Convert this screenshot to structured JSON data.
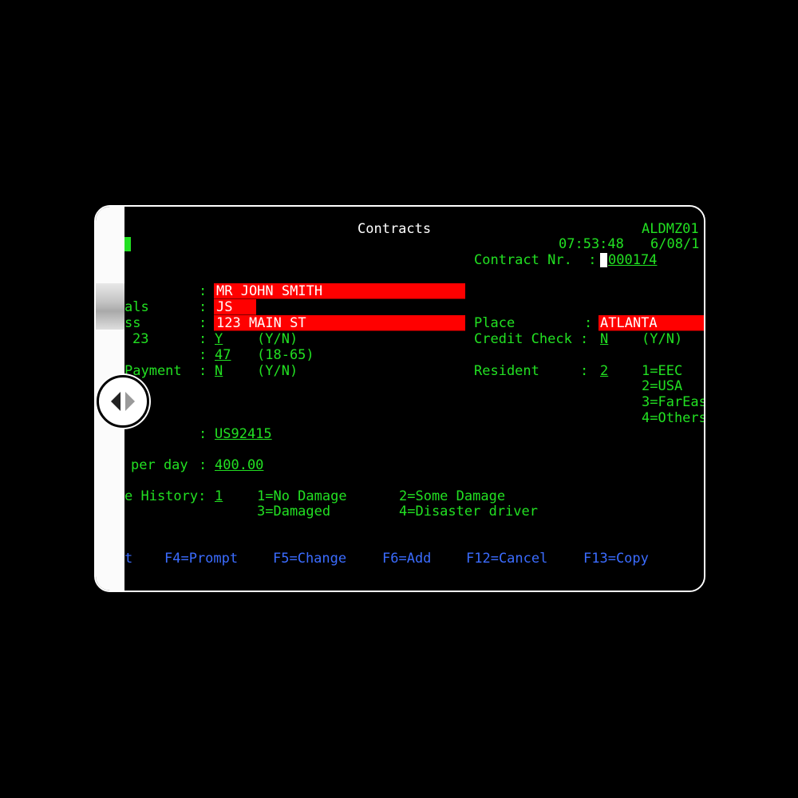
{
  "screen": {
    "title": "Contracts",
    "program_id": "ALDMZ01",
    "time": "07:53:48",
    "date": "6/08/1",
    "contract_label": "Contract Nr.  :",
    "contract_value": "000174"
  },
  "left_fields": {
    "name_value": "MR JOHN SMITH",
    "initials_label": "als",
    "initials_value": "JS",
    "address_label": "ss",
    "address_value": "123 MAIN ST",
    "row4_label": "23",
    "row4_value": "Y",
    "row4_hint": "(Y/N)",
    "age_value": "47",
    "age_hint": "(18-65)",
    "payment_label": "Payment",
    "payment_value": "N",
    "payment_hint": "(Y/N)",
    "id_value": "US92415",
    "rate_label": "per day",
    "rate_value": "400.00",
    "history_label": "e History:",
    "history_value": "1"
  },
  "history_options": {
    "opt1": "1=No Damage",
    "opt2": "2=Some Damage",
    "opt3": "3=Damaged",
    "opt4": "4=Disaster driver"
  },
  "right_fields": {
    "place_label": "Place",
    "place_value": "ATLANTA",
    "credit_label": "Credit Check :",
    "credit_value": "N",
    "credit_hint": "(Y/N)",
    "resident_label": "Resident     :",
    "resident_value": "2",
    "resident_options": [
      "1=EEC",
      "2=USA",
      "3=FarEas",
      "4=Others"
    ]
  },
  "function_keys": {
    "f_partial": "t",
    "f4": "F4=Prompt",
    "f5": "F5=Change",
    "f6": "F6=Add",
    "f12": "F12=Cancel",
    "f13": "F13=Copy"
  },
  "colors": {
    "text_green": "#22e022",
    "field_red": "#ff0000",
    "fkey_blue": "#3b6cff"
  },
  "icons": {
    "toggle": "left-right-arrows-icon"
  }
}
